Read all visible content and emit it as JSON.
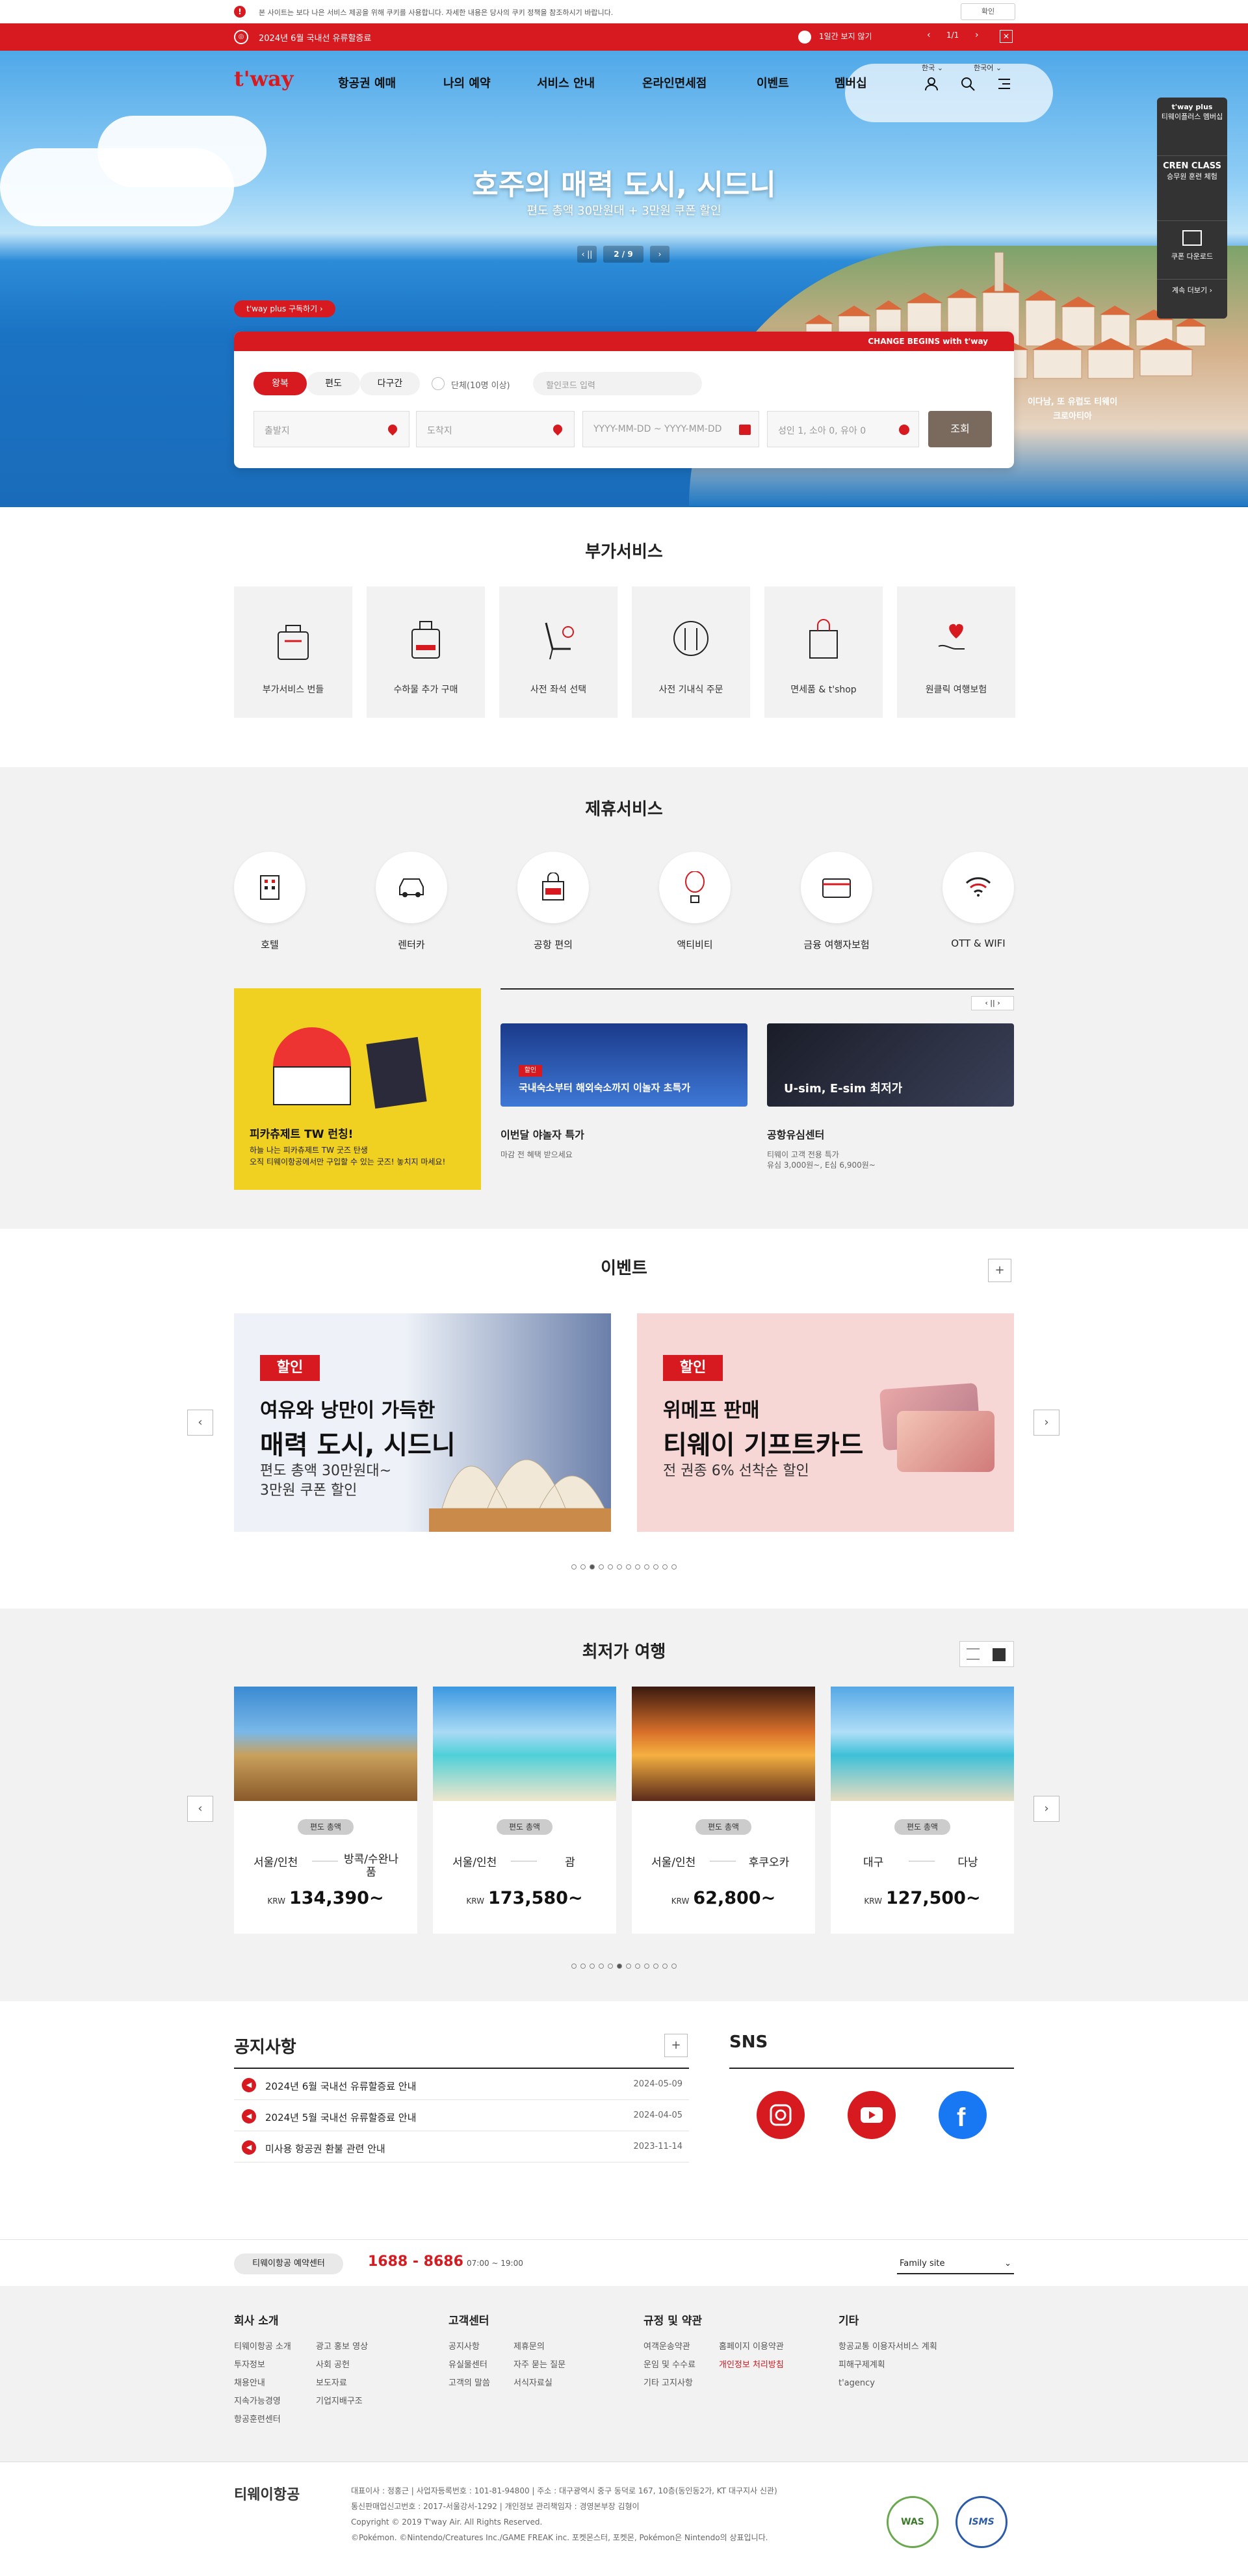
{
  "cookie": {
    "text": "본 사이트는 보다 나은 서비스 제공을 위해 쿠키를 사용합니다. 자세한 내용은 당사의 쿠키 정책을 참조하시기 바랍니다.",
    "confirm": "확인"
  },
  "notice_bar": {
    "text": "2024년 6월 국내선 유류할증료",
    "hide_day": "1일간 보지 않기",
    "page": "1/1",
    "close": "✕"
  },
  "header": {
    "logo": "t'way",
    "nav": [
      "항공권 예매",
      "나의 예약",
      "서비스 안내",
      "온라인면세점",
      "이벤트",
      "멤버십"
    ],
    "lang1": "한국 ⌄",
    "lang2": "한국어 ⌄"
  },
  "hero": {
    "title": "호주의 매력 도시, 시드니",
    "subtitle": "편도 총액 30만원대 + 3만원 쿠폰 할인",
    "page": "2 / 9",
    "plus_badge": "t'way plus 구독하기 ›",
    "deco": "이다남, 또 유럽도 티웨이 크로아티아"
  },
  "side_panel": {
    "plus": "t'way plus",
    "plus_sub": "티웨이플러스 멤버십",
    "cren": "CREN CLASS",
    "cren_sub": "승무원 훈련 체험",
    "coupon": "쿠폰 다운로드",
    "more": "계속 더보기 ›"
  },
  "booking": {
    "slogan": "CHANGE BEGINS with t'way",
    "tabs": [
      "왕복",
      "편도",
      "다구간"
    ],
    "group": "단체(10명 이상)",
    "promo_placeholder": "할인코드 입력",
    "from_placeholder": "출발지",
    "to_placeholder": "도착지",
    "date_from": "YYYY-MM-DD",
    "date_sep": "~",
    "date_to": "YYYY-MM-DD",
    "pax": "성인 1, 소아 0, 유아 0",
    "search": "조회"
  },
  "addons": {
    "title": "부가서비스",
    "items": [
      "부가서비스 번들",
      "수하물 추가 구매",
      "사전 좌석 선택",
      "사전 기내식 주문",
      "면세품 & t'shop",
      "원클릭 여행보험"
    ]
  },
  "partners": {
    "title": "제휴서비스",
    "items": [
      "호텔",
      "렌터카",
      "공항 편의",
      "액티비티",
      "금융 여행자보험",
      "OTT & WIFI"
    ]
  },
  "promo": {
    "title": "피카츄제트 TW 런칭!",
    "desc1": "하늘 나는 피카츄제트 TW 굿즈 탄생",
    "desc2": "오직 티웨이항공에서만 구입할 수 있는 굿즈! 놓치지 마세요!"
  },
  "cards": [
    {
      "img_text": "국내숙소부터 해외숙소까지 이놀자 초특가",
      "badge": "할인",
      "title": "이번달 야놀자 특가",
      "desc": "마감 전 혜택 받으세요"
    },
    {
      "img_text": "U-sim, E-sim 최저가",
      "title": "공항유심센터",
      "desc1": "티웨이 고객 전용 특가",
      "desc2": "유심 3,000원~, E심 6,900원~"
    }
  ],
  "events": {
    "title": "이벤트",
    "plus": "+",
    "items": [
      {
        "tag": "할인",
        "line1": "여유와 낭만이 가득한",
        "line2": "매력 도시, 시드니",
        "sub1": "편도 총액 30만원대~",
        "sub2": "3만원 쿠폰 할인"
      },
      {
        "tag": "할인",
        "line1": "위메프 판매",
        "line2": "티웨이 기프트카드",
        "sub1": "전 권종 6% 선착순 할인"
      }
    ]
  },
  "lowest": {
    "title": "최저가 여행",
    "badge": "편도 총액",
    "currency": "KRW",
    "items": [
      {
        "from": "서울/인천",
        "to": "방콕/수완나품",
        "price": "134,390~"
      },
      {
        "from": "서울/인천",
        "to": "괌",
        "price": "173,580~"
      },
      {
        "from": "서울/인천",
        "to": "후쿠오카",
        "price": "62,800~"
      },
      {
        "from": "대구",
        "to": "다낭",
        "price": "127,500~"
      }
    ]
  },
  "notices": {
    "title": "공지사항",
    "plus": "+",
    "items": [
      {
        "title": "2024년 6월 국내선 유류할증료 안내",
        "date": "2024-05-09"
      },
      {
        "title": "2024년 5월 국내선 유류할증료 안내",
        "date": "2024-04-05"
      },
      {
        "title": "미사용 항공권 환불 관련 안내",
        "date": "2023-11-14"
      }
    ]
  },
  "sns": {
    "title": "SNS"
  },
  "contact": {
    "label": "티웨이항공 예약센터",
    "phone": "1688 - 8686",
    "hours": "07:00 ~ 19:00",
    "family": "Family site"
  },
  "footer": {
    "cols": [
      {
        "title": "회사 소개",
        "links": [
          "티웨이항공 소개",
          "투자정보",
          "채용안내",
          "지속가능경영",
          "항공훈련센터"
        ]
      },
      {
        "title": "",
        "links": [
          "광고 홍보 영상",
          "사회 공헌",
          "보도자료",
          "기업지배구조"
        ]
      },
      {
        "title": "고객센터",
        "links": [
          "공지사항",
          "유실물센터",
          "고객의 말씀"
        ]
      },
      {
        "title": "",
        "links": [
          "제휴문의",
          "자주 묻는 질문",
          "서식자료실"
        ]
      },
      {
        "title": "규정 및 약관",
        "links": [
          "여객운송약관",
          "운임 및 수수료",
          "기타 고지사항"
        ]
      },
      {
        "title": "",
        "links": [
          "홈페이지 이용약관",
          "개인정보 처리방침"
        ]
      },
      {
        "title": "기타",
        "links": [
          "항공교통 이용자서비스 계획",
          "피해구제계획",
          "t'agency"
        ]
      }
    ],
    "company": "티웨이항공",
    "info1": "대표이사 : 정홍근   |   사업자등록번호 : 101-81-94800   |   주소 : 대구광역시 중구 동덕로 167, 10층(동인동2가, KT 대구지사 신관)",
    "info2": "통신판매업신고번호 : 2017-서울강서-1292   |   개인정보 관리책임자 : 경영본부장 김형이",
    "info3": "Copyright © 2019 T'way Air. All Rights Reserved.",
    "info4": "©Pokémon. ©Nintendo/Creatures Inc./GAME FREAK inc. 포켓몬스터, 포켓몬, Pokémon은 Nintendo의 상표입니다.",
    "badge1": "WAS",
    "badge2": "ISMS"
  }
}
